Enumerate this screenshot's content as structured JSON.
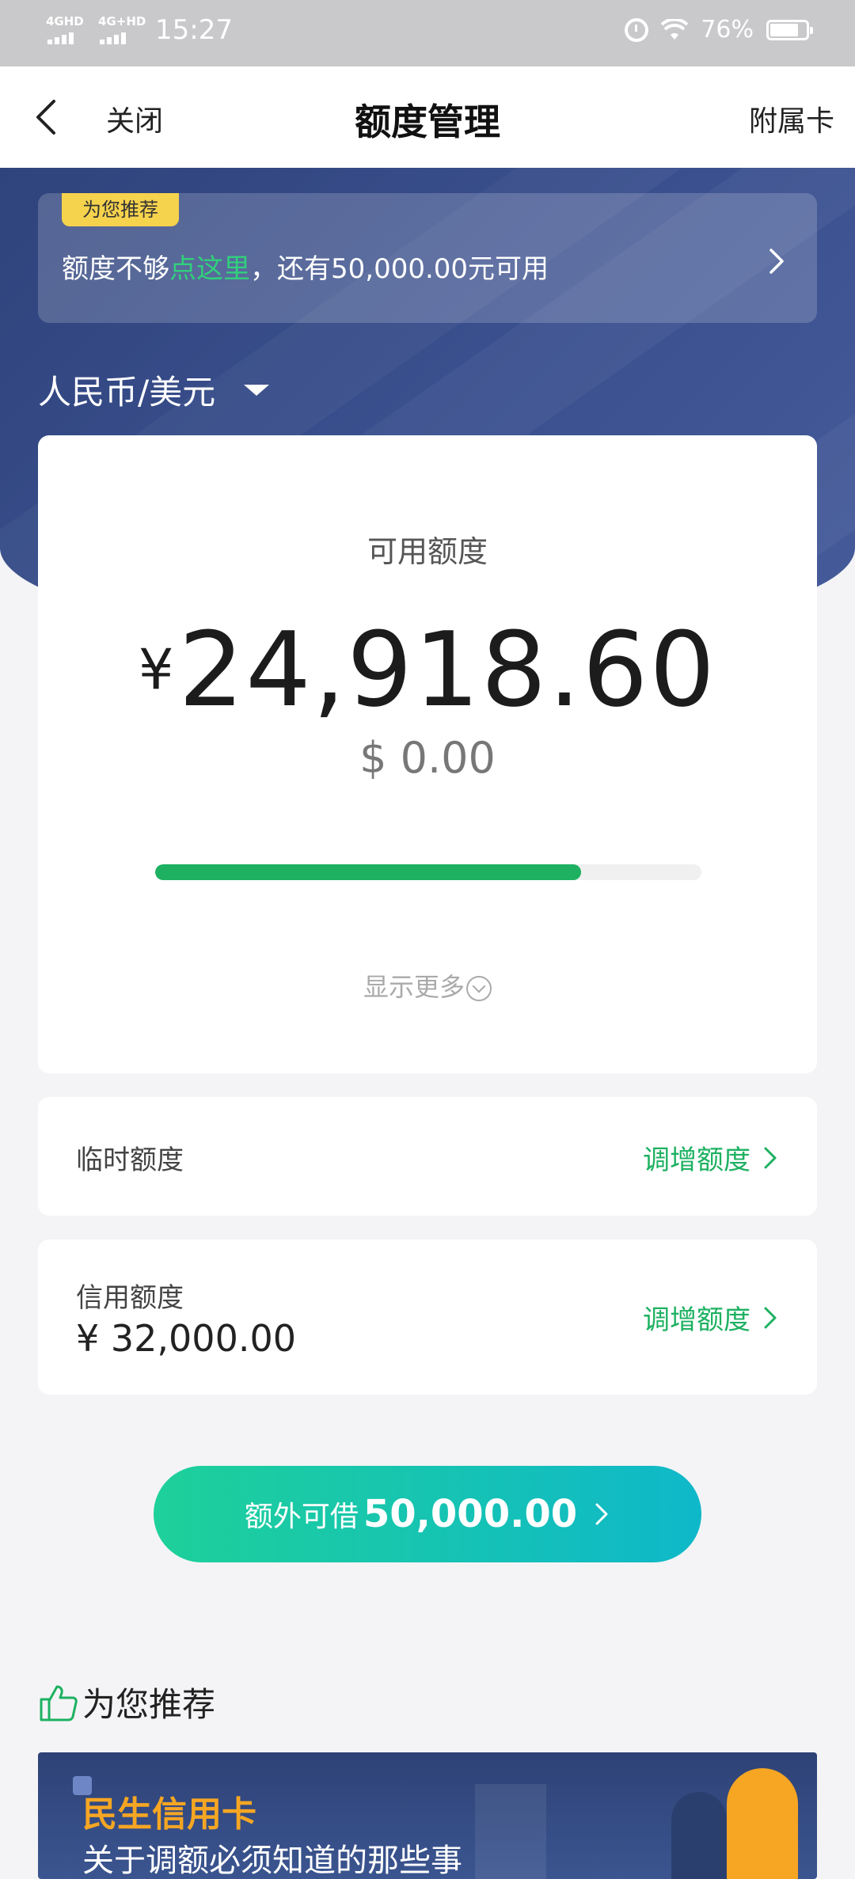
{
  "status_bar": {
    "signal1": "4GHD",
    "signal2": "4G+HD",
    "time": "15:27",
    "battery": "76%"
  },
  "nav": {
    "close": "关闭",
    "title": "额度管理",
    "secondary": "附属卡"
  },
  "promo": {
    "tag": "为您推荐",
    "text_before": "额度不够",
    "text_highlight": "点这里",
    "text_after": "，还有50,000.00元可用"
  },
  "currency_selector": "人民币/美元",
  "limit_card": {
    "label": "可用额度",
    "symbol": "¥",
    "amount": "24,918.60",
    "usd": "$ 0.00",
    "usage_fraction": 0.78,
    "show_more": "显示更多"
  },
  "temporary_limit": {
    "label": "临时额度",
    "action": "调增额度"
  },
  "credit_limit": {
    "label": "信用额度",
    "amount": "¥ 32,000.00",
    "action": "调增额度"
  },
  "cta": {
    "prefix": "额外可借",
    "amount": "50,000.00"
  },
  "recommend": {
    "title": "为您推荐",
    "brand": "民生信用卡",
    "subtitle": "关于调额必须知道的那些事"
  },
  "colors": {
    "accent_green": "#1db161",
    "hero_navy": "#34498a",
    "tag_yellow": "#f6d34d"
  }
}
